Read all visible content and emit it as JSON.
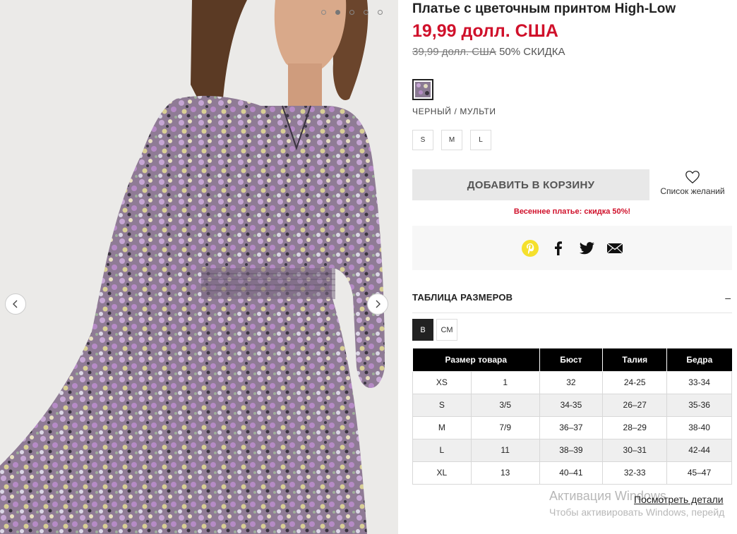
{
  "product": {
    "title": "Платье с цветочным принтом High-Low",
    "price_now": "19,99 долл. США",
    "price_old": "39,99 долл. США",
    "discount": "50% СКИДКА",
    "color_name": "ЧЕРНЫЙ / МУЛЬТИ",
    "sizes": [
      "S",
      "M",
      "L"
    ],
    "add_to_cart": "ДОБАВИТЬ В КОРЗИНУ",
    "wishlist": "Список желаний",
    "promo": "Весеннее платье: скидка 50%!"
  },
  "gallery": {
    "image_count": 5,
    "active_index": 1
  },
  "share": {
    "icons": [
      "pinterest-icon",
      "facebook-icon",
      "twitter-icon",
      "email-icon"
    ],
    "pinterest_color": "#f5e02d"
  },
  "size_chart": {
    "heading": "ТАБЛИЦА РАЗМЕРОВ",
    "toggle": "–",
    "units": [
      "В",
      "СМ"
    ],
    "active_unit": "В",
    "headers": [
      "Размер товара",
      "Бюст",
      "Талия",
      "Бедра"
    ],
    "rows": [
      [
        "XS",
        "1",
        "32",
        "24-25",
        "33-34"
      ],
      [
        "S",
        "3/5",
        "34-35",
        "26–27",
        "35-36"
      ],
      [
        "M",
        "7/9",
        "36–37",
        "28–29",
        "38-40"
      ],
      [
        "L",
        "11",
        "38–39",
        "30–31",
        "42-44"
      ],
      [
        "XL",
        "13",
        "40–41",
        "32-33",
        "45–47"
      ]
    ]
  },
  "system": {
    "watermark": "Активация Windows",
    "watermark_sub": "Чтобы активировать Windows, перейд",
    "details_link": "Посмотреть детали"
  },
  "colors": {
    "accent_red": "#d0112b",
    "header_black": "#000000"
  }
}
